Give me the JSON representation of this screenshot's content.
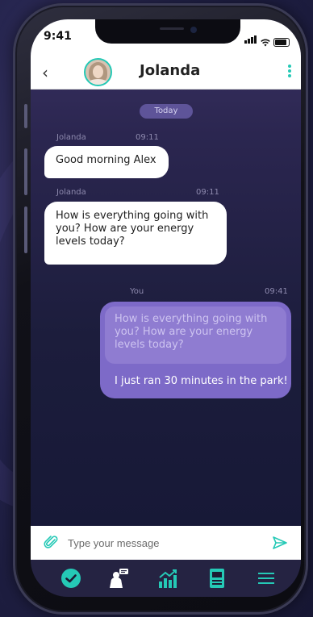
{
  "status": {
    "time": "9:41"
  },
  "header": {
    "contact_name": "Jolanda"
  },
  "chat": {
    "date_label": "Today",
    "messages": [
      {
        "sender": "Jolanda",
        "time": "09:11",
        "text": "Good morning Alex"
      },
      {
        "sender": "Jolanda",
        "time": "09:11",
        "text": "How is everything going with you? How are your energy levels today?"
      },
      {
        "sender": "You",
        "time": "09:41",
        "quoted_text": "How is everything going with you? How are your energy levels today?",
        "text": "I just ran 30 minutes in the park!"
      }
    ]
  },
  "composer": {
    "placeholder": "Type your message",
    "value": ""
  },
  "tabbar": {
    "items": [
      {
        "icon": "check-circle-icon"
      },
      {
        "icon": "coach-icon"
      },
      {
        "icon": "stats-chart-icon"
      },
      {
        "icon": "journal-icon"
      },
      {
        "icon": "menu-icon"
      }
    ]
  },
  "colors": {
    "accent": "#25c9b6",
    "bubble_out": "#7d6ac8",
    "tabbar": "#252342"
  }
}
